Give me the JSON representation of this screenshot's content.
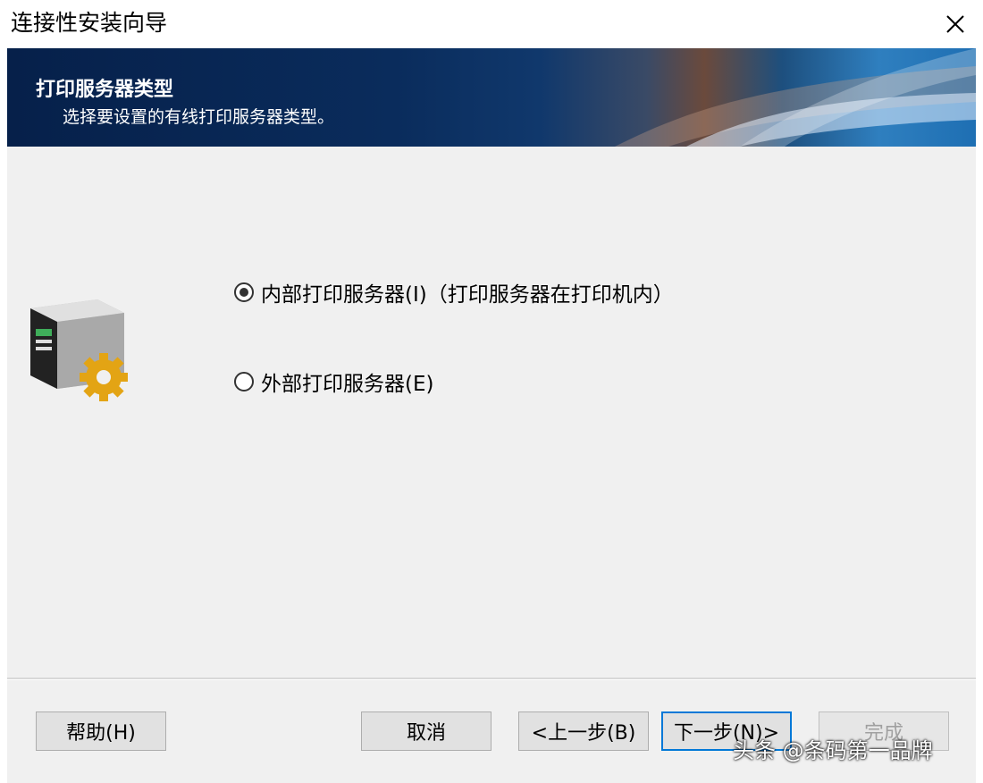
{
  "window": {
    "title": "连接性安装向导"
  },
  "banner": {
    "title": "打印服务器类型",
    "subtitle": "选择要设置的有线打印服务器类型。"
  },
  "options": [
    {
      "label": "内部打印服务器(I)（打印服务器在打印机内）",
      "checked": true
    },
    {
      "label": "外部打印服务器(E)",
      "checked": false
    }
  ],
  "buttons": {
    "help": "帮助(H)",
    "cancel": "取消",
    "back": "<上一步(B)",
    "next": "下一步(N)>",
    "finish": "完成"
  },
  "watermark": "头条 @条码第一品牌",
  "colors": {
    "accent": "#0078d7",
    "banner_dark": "#06204a"
  },
  "icons": {
    "close": "close-icon",
    "printer": "printer-gear-icon"
  }
}
